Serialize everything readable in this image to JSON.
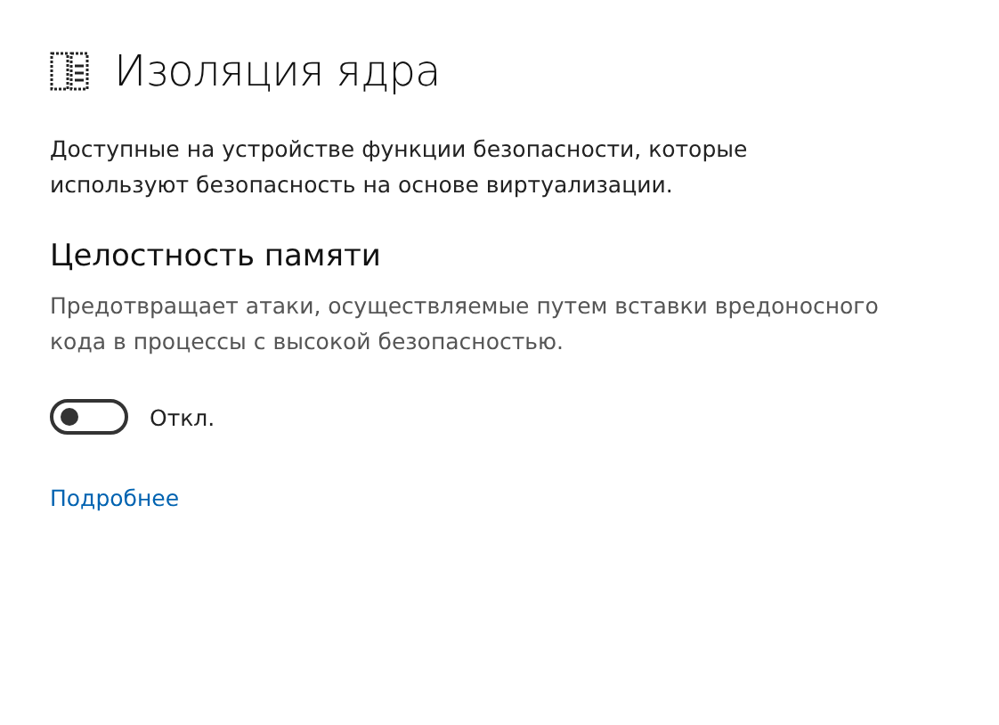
{
  "title": "Изоляция ядра",
  "description": "Доступные на устройстве функции безопасности, которые используют безопасность на основе виртуализации.",
  "section": {
    "title": "Целостность памяти",
    "description": "Предотвращает атаки, осуществляемые путем вставки вредоносного кода в процессы с высокой безопасностью.",
    "toggle": {
      "on": false,
      "label": "Откл."
    }
  },
  "link": "Подробнее"
}
